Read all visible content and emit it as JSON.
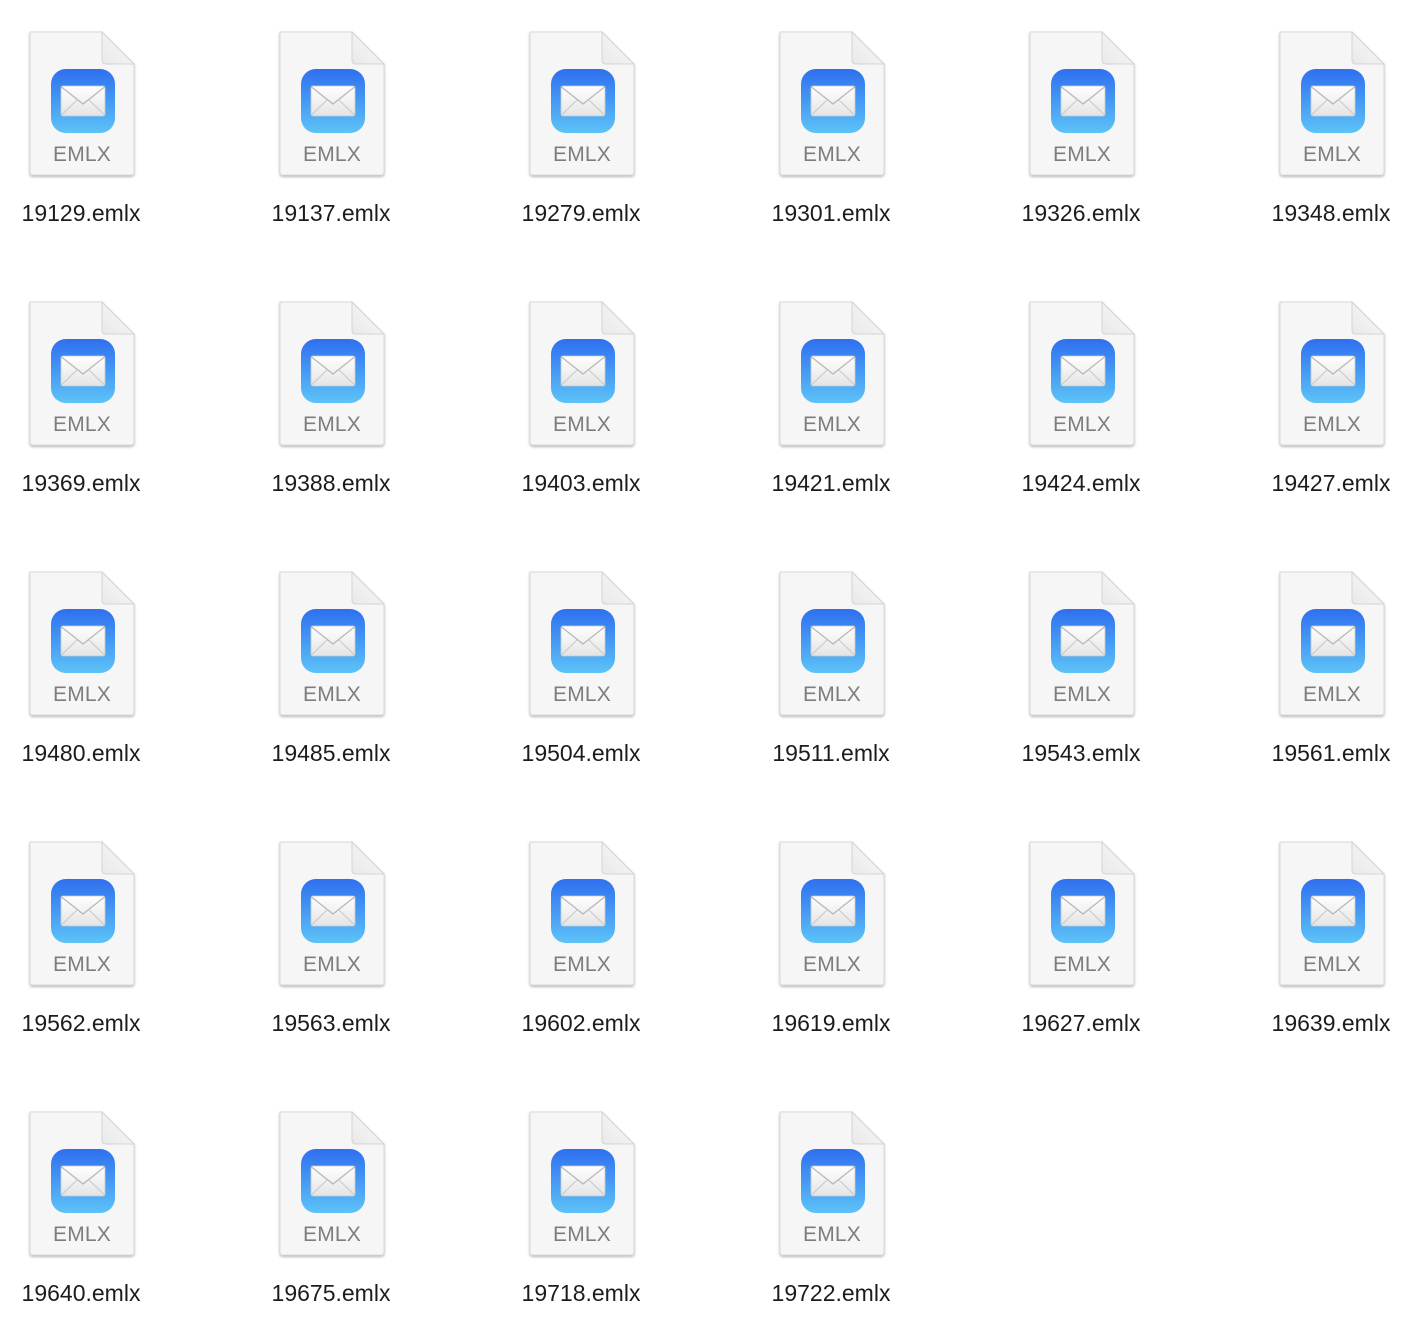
{
  "files": [
    {
      "name": "19129.emlx",
      "type_label": "EMLX"
    },
    {
      "name": "19137.emlx",
      "type_label": "EMLX"
    },
    {
      "name": "19279.emlx",
      "type_label": "EMLX"
    },
    {
      "name": "19301.emlx",
      "type_label": "EMLX"
    },
    {
      "name": "19326.emlx",
      "type_label": "EMLX"
    },
    {
      "name": "19348.emlx",
      "type_label": "EMLX"
    },
    {
      "name": "19369.emlx",
      "type_label": "EMLX"
    },
    {
      "name": "19388.emlx",
      "type_label": "EMLX"
    },
    {
      "name": "19403.emlx",
      "type_label": "EMLX"
    },
    {
      "name": "19421.emlx",
      "type_label": "EMLX"
    },
    {
      "name": "19424.emlx",
      "type_label": "EMLX"
    },
    {
      "name": "19427.emlx",
      "type_label": "EMLX"
    },
    {
      "name": "19480.emlx",
      "type_label": "EMLX"
    },
    {
      "name": "19485.emlx",
      "type_label": "EMLX"
    },
    {
      "name": "19504.emlx",
      "type_label": "EMLX"
    },
    {
      "name": "19511.emlx",
      "type_label": "EMLX"
    },
    {
      "name": "19543.emlx",
      "type_label": "EMLX"
    },
    {
      "name": "19561.emlx",
      "type_label": "EMLX"
    },
    {
      "name": "19562.emlx",
      "type_label": "EMLX"
    },
    {
      "name": "19563.emlx",
      "type_label": "EMLX"
    },
    {
      "name": "19602.emlx",
      "type_label": "EMLX"
    },
    {
      "name": "19619.emlx",
      "type_label": "EMLX"
    },
    {
      "name": "19627.emlx",
      "type_label": "EMLX"
    },
    {
      "name": "19639.emlx",
      "type_label": "EMLX"
    },
    {
      "name": "19640.emlx",
      "type_label": "EMLX"
    },
    {
      "name": "19675.emlx",
      "type_label": "EMLX"
    },
    {
      "name": "19718.emlx",
      "type_label": "EMLX"
    },
    {
      "name": "19722.emlx",
      "type_label": "EMLX"
    }
  ],
  "icon": {
    "document": "document-icon",
    "badge": "mail-envelope-icon"
  },
  "colors": {
    "background": "#ffffff",
    "page_fill": "#f7f7f7",
    "badge_top": "#2f6ff0",
    "badge_bottom": "#5cc3f7",
    "label_gray": "#7d7d7d",
    "filename": "#1c1c1c"
  }
}
